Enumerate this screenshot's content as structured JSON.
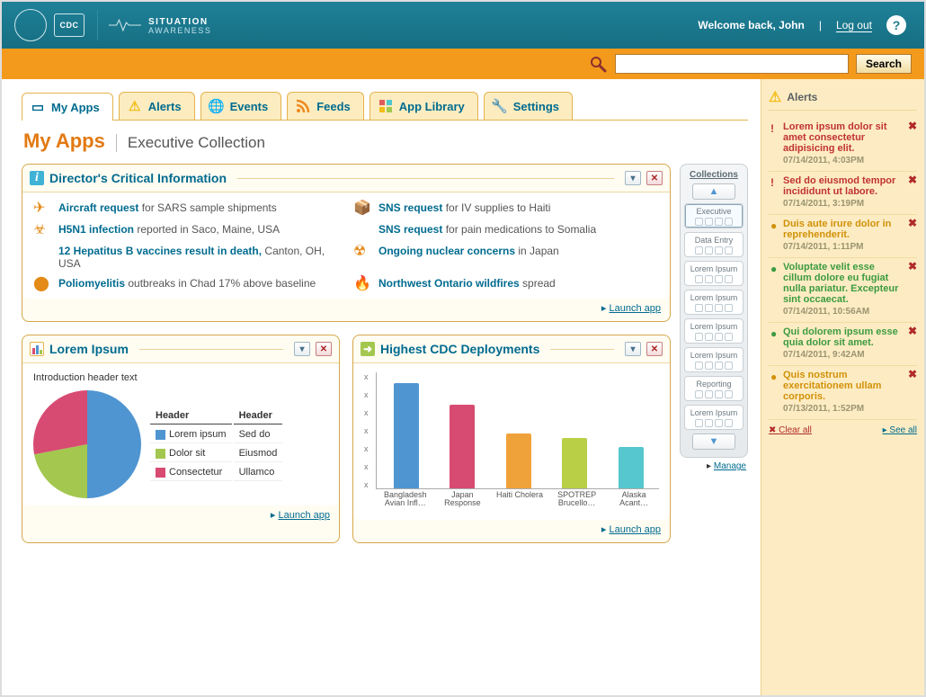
{
  "header": {
    "cdc": "CDC",
    "brand_line1": "SITUATION",
    "brand_line2": "AWARENESS",
    "welcome": "Welcome back, John",
    "logout": "Log out",
    "help": "?"
  },
  "search": {
    "placeholder": "",
    "button": "Search"
  },
  "tabs": [
    {
      "label": "My Apps",
      "active": true
    },
    {
      "label": "Alerts"
    },
    {
      "label": "Events"
    },
    {
      "label": "Feeds"
    },
    {
      "label": "App Library"
    },
    {
      "label": "Settings"
    }
  ],
  "page": {
    "title": "My Apps",
    "subtitle": "Executive Collection"
  },
  "dci": {
    "heading": "Director's Critical Information",
    "launch": "Launch app",
    "items_left": [
      {
        "bold": "Aircraft request",
        "rest": " for SARS sample shipments"
      },
      {
        "bold": "H5N1 infection",
        "rest": " reported in Saco, Maine, USA"
      },
      {
        "bold": "12 Hepatitus B vaccines result in death, ",
        "rest": "Canton, OH, USA"
      },
      {
        "bold": "Poliomyelitis",
        "rest": " outbreaks in Chad 17% above baseline"
      }
    ],
    "items_right": [
      {
        "bold": "SNS request",
        "rest": " for IV supplies to Haiti"
      },
      {
        "bold": "SNS request",
        "rest": " for pain medications to Somalia"
      },
      {
        "bold": "Ongoing nuclear concerns",
        "rest": " in Japan"
      },
      {
        "bold": "Northwest Ontario wildfires",
        "rest": " spread"
      }
    ]
  },
  "lorem_panel": {
    "heading": "Lorem Ipsum",
    "intro": "Introduction header text",
    "launch": "Launch app",
    "legend_h1": "Header",
    "legend_h2": "Header",
    "rows": [
      {
        "color": "#4f95d1",
        "l": "Lorem ipsum",
        "r": "Sed do"
      },
      {
        "color": "#a3c74f",
        "l": "Dolor sit",
        "r": "Eiusmod"
      },
      {
        "color": "#d74b72",
        "l": "Consectetur",
        "r": "Ullamco"
      }
    ]
  },
  "deploy_panel": {
    "heading": "Highest CDC Deployments",
    "launch": "Launch app",
    "yaxis_label": "x"
  },
  "chart_data": [
    {
      "type": "pie",
      "title": "Lorem Ipsum",
      "series": [
        {
          "name": "Lorem ipsum",
          "value": 50,
          "color": "#4f95d1"
        },
        {
          "name": "Dolor sit",
          "value": 22,
          "color": "#a3c74f"
        },
        {
          "name": "Consectetur",
          "value": 28,
          "color": "#d74b72"
        }
      ]
    },
    {
      "type": "bar",
      "title": "Highest CDC Deployments",
      "categories": [
        "Bangladesh Avian Infl…",
        "Japan Response",
        "Haiti Cholera",
        "SPOTREP Brucello…",
        "Alaska Acant…"
      ],
      "values": [
        6.3,
        5.0,
        3.3,
        3.0,
        2.5
      ],
      "colors": [
        "#4f95d1",
        "#d74b72",
        "#f0a23a",
        "#b9cf46",
        "#56c7cf"
      ],
      "ylim": [
        0,
        7
      ],
      "ticks": 7
    }
  ],
  "collections": {
    "heading": "Collections",
    "items": [
      "Executive",
      "Data Entry",
      "Lorem Ipsum",
      "Lorem Ipsum",
      "Lorem Ipsum",
      "Lorem Ipsum",
      "Reporting",
      "Lorem Ipsum"
    ],
    "manage": "Manage"
  },
  "alerts": {
    "heading": "Alerts",
    "items": [
      {
        "sev": "red",
        "msg": "Lorem ipsum dolor sit amet consectetur adipisicing elit.",
        "ts": "07/14/2011, 4:03PM"
      },
      {
        "sev": "red",
        "msg": "Sed do eiusmod tempor incididunt ut labore.",
        "ts": "07/14/2011, 3:19PM"
      },
      {
        "sev": "amber",
        "msg": "Duis aute irure dolor in reprehenderit.",
        "ts": "07/14/2011, 1:11PM"
      },
      {
        "sev": "green",
        "msg": "Voluptate velit esse cillum dolore eu fugiat nulla pariatur. Excepteur sint occaecat.",
        "ts": "07/14/2011, 10:56AM"
      },
      {
        "sev": "green",
        "msg": "Qui dolorem ipsum esse quia dolor sit amet.",
        "ts": "07/14/2011, 9:42AM"
      },
      {
        "sev": "amber",
        "msg": "Quis nostrum exercitationem ullam corporis.",
        "ts": "07/13/2011, 1:52PM"
      }
    ],
    "clear": "Clear all",
    "see": "See all"
  }
}
